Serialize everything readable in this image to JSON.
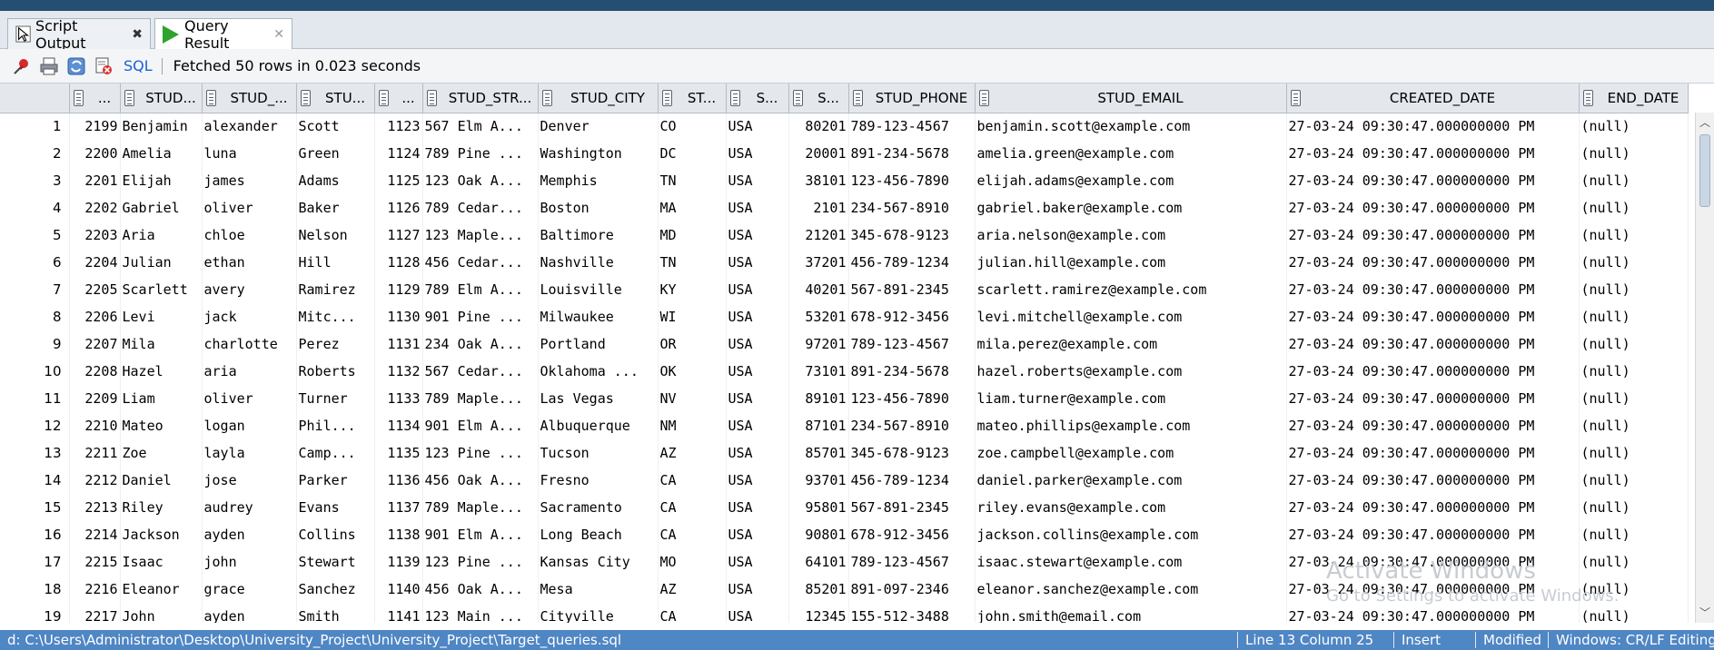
{
  "tabs": [
    {
      "label": "Script Output",
      "close": "✖"
    },
    {
      "label": "Query Result",
      "close": "✕"
    }
  ],
  "toolbar": {
    "sql_label": "SQL",
    "status": "Fetched 50 rows in 0.023 seconds"
  },
  "grid": {
    "columns": [
      "",
      "...",
      "STUD...",
      "STUD_...",
      "STU...",
      "...",
      "STUD_STR...",
      "STUD_CITY",
      "ST...",
      "S...",
      "S...",
      "STUD_PHONE",
      "STUD_EMAIL",
      "CREATED_DATE",
      "END_DATE"
    ],
    "rows": [
      [
        "1",
        "2199",
        "Benjamin",
        "alexander",
        "Scott",
        "1123",
        "567 Elm A...",
        "Denver",
        "CO",
        "USA",
        "80201",
        "789-123-4567",
        "benjamin.scott@example.com",
        "27-03-24 09:30:47.000000000 PM",
        "(null)"
      ],
      [
        "2",
        "2200",
        "Amelia",
        "luna",
        "Green",
        "1124",
        "789 Pine ...",
        "Washington",
        "DC",
        "USA",
        "20001",
        "891-234-5678",
        "amelia.green@example.com",
        "27-03-24 09:30:47.000000000 PM",
        "(null)"
      ],
      [
        "3",
        "2201",
        "Elijah",
        "james",
        "Adams",
        "1125",
        "123 Oak A...",
        "Memphis",
        "TN",
        "USA",
        "38101",
        "123-456-7890",
        "elijah.adams@example.com",
        "27-03-24 09:30:47.000000000 PM",
        "(null)"
      ],
      [
        "4",
        "2202",
        "Gabriel",
        "oliver",
        "Baker",
        "1126",
        "789 Cedar...",
        "Boston",
        "MA",
        "USA",
        "2101",
        "234-567-8910",
        "gabriel.baker@example.com",
        "27-03-24 09:30:47.000000000 PM",
        "(null)"
      ],
      [
        "5",
        "2203",
        "Aria",
        "chloe",
        "Nelson",
        "1127",
        "123 Maple...",
        "Baltimore",
        "MD",
        "USA",
        "21201",
        "345-678-9123",
        "aria.nelson@example.com",
        "27-03-24 09:30:47.000000000 PM",
        "(null)"
      ],
      [
        "6",
        "2204",
        "Julian",
        "ethan",
        "Hill",
        "1128",
        "456 Cedar...",
        "Nashville",
        "TN",
        "USA",
        "37201",
        "456-789-1234",
        "julian.hill@example.com",
        "27-03-24 09:30:47.000000000 PM",
        "(null)"
      ],
      [
        "7",
        "2205",
        "Scarlett",
        "avery",
        "Ramirez",
        "1129",
        "789 Elm A...",
        "Louisville",
        "KY",
        "USA",
        "40201",
        "567-891-2345",
        "scarlett.ramirez@example.com",
        "27-03-24 09:30:47.000000000 PM",
        "(null)"
      ],
      [
        "8",
        "2206",
        "Levi",
        "jack",
        "Mitc...",
        "1130",
        "901 Pine ...",
        "Milwaukee",
        "WI",
        "USA",
        "53201",
        "678-912-3456",
        "levi.mitchell@example.com",
        "27-03-24 09:30:47.000000000 PM",
        "(null)"
      ],
      [
        "9",
        "2207",
        "Mila",
        "charlotte",
        "Perez",
        "1131",
        "234 Oak A...",
        "Portland",
        "OR",
        "USA",
        "97201",
        "789-123-4567",
        "mila.perez@example.com",
        "27-03-24 09:30:47.000000000 PM",
        "(null)"
      ],
      [
        "10",
        "2208",
        "Hazel",
        "aria",
        "Roberts",
        "1132",
        "567 Cedar...",
        "Oklahoma ...",
        "OK",
        "USA",
        "73101",
        "891-234-5678",
        "hazel.roberts@example.com",
        "27-03-24 09:30:47.000000000 PM",
        "(null)"
      ],
      [
        "11",
        "2209",
        "Liam",
        "oliver",
        "Turner",
        "1133",
        "789 Maple...",
        "Las Vegas",
        "NV",
        "USA",
        "89101",
        "123-456-7890",
        "liam.turner@example.com",
        "27-03-24 09:30:47.000000000 PM",
        "(null)"
      ],
      [
        "12",
        "2210",
        "Mateo",
        "logan",
        "Phil...",
        "1134",
        "901 Elm A...",
        "Albuquerque",
        "NM",
        "USA",
        "87101",
        "234-567-8910",
        "mateo.phillips@example.com",
        "27-03-24 09:30:47.000000000 PM",
        "(null)"
      ],
      [
        "13",
        "2211",
        "Zoe",
        "layla",
        "Camp...",
        "1135",
        "123 Pine ...",
        "Tucson",
        "AZ",
        "USA",
        "85701",
        "345-678-9123",
        "zoe.campbell@example.com",
        "27-03-24 09:30:47.000000000 PM",
        "(null)"
      ],
      [
        "14",
        "2212",
        "Daniel",
        "jose",
        "Parker",
        "1136",
        "456 Oak A...",
        "Fresno",
        "CA",
        "USA",
        "93701",
        "456-789-1234",
        "daniel.parker@example.com",
        "27-03-24 09:30:47.000000000 PM",
        "(null)"
      ],
      [
        "15",
        "2213",
        "Riley",
        "audrey",
        "Evans",
        "1137",
        "789 Maple...",
        "Sacramento",
        "CA",
        "USA",
        "95801",
        "567-891-2345",
        "riley.evans@example.com",
        "27-03-24 09:30:47.000000000 PM",
        "(null)"
      ],
      [
        "16",
        "2214",
        "Jackson",
        "ayden",
        "Collins",
        "1138",
        "901 Elm A...",
        "Long Beach",
        "CA",
        "USA",
        "90801",
        "678-912-3456",
        "jackson.collins@example.com",
        "27-03-24 09:30:47.000000000 PM",
        "(null)"
      ],
      [
        "17",
        "2215",
        "Isaac",
        "john",
        "Stewart",
        "1139",
        "123 Pine ...",
        "Kansas City",
        "MO",
        "USA",
        "64101",
        "789-123-4567",
        "isaac.stewart@example.com",
        "27-03-24 09:30:47.000000000 PM",
        "(null)"
      ],
      [
        "18",
        "2216",
        "Eleanor",
        "grace",
        "Sanchez",
        "1140",
        "456 Oak A...",
        "Mesa",
        "AZ",
        "USA",
        "85201",
        "891-097-2346",
        "eleanor.sanchez@example.com",
        "27-03-24 09:30:47.000000000 PM",
        "(null)"
      ],
      [
        "19",
        "2217",
        "John",
        "ayden",
        "Smith",
        "1141",
        "123 Main ...",
        "Cityville",
        "CA",
        "USA",
        "12345",
        "155-512-3488",
        "john.smith@email.com",
        "27-03-24 09:30:47.000000000 PM",
        "(null)"
      ]
    ]
  },
  "watermark": {
    "line1": "Activate Windows",
    "line2": "Go to Settings to activate Windows."
  },
  "statusbar": {
    "path": "d: C:\\Users\\Administrator\\Desktop\\University_Project\\University_Project\\Target_queries.sql",
    "position": "Line 13 Column 25",
    "mode": "Insert",
    "state": "Modified",
    "line_endings": "Windows: CR/LF Editing"
  }
}
